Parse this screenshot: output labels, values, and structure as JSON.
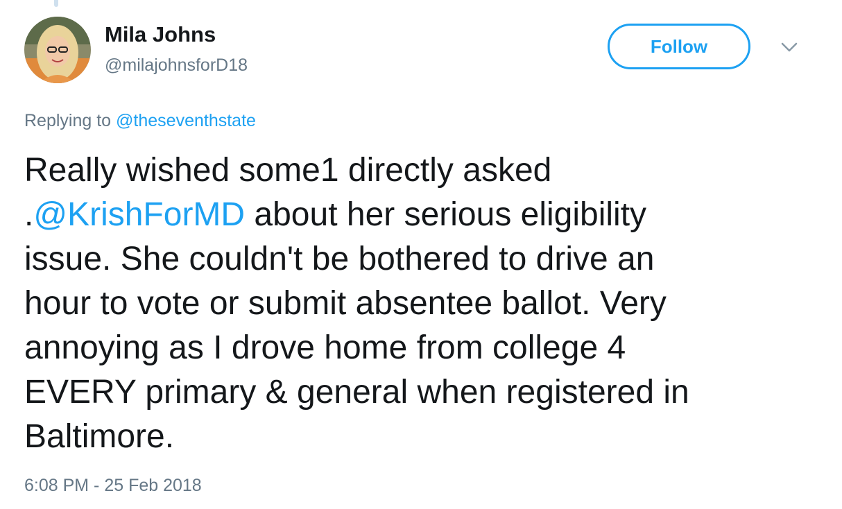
{
  "user": {
    "display_name": "Mila Johns",
    "handle": "@milajohnsforD18"
  },
  "follow_button": {
    "label": "Follow"
  },
  "menu": {
    "icon": "chevron-down-icon"
  },
  "reply": {
    "prefix": "Replying to ",
    "mention": "@theseventhstate"
  },
  "tweet": {
    "line1": "Really wished some1 directly asked",
    "line2_prefix": ".",
    "line2_mention": "@KrishForMD",
    "line2_rest": " about her serious eligibility",
    "line3": "issue. She couldn't be bothered to drive an",
    "line4": "hour to vote or submit absentee ballot. Very",
    "line5": "annoying as I drove home from college 4",
    "line6": "EVERY primary & general when registered in",
    "line7": "Baltimore."
  },
  "timestamp": "6:08 PM - 25 Feb 2018",
  "colors": {
    "accent": "#1da1f2",
    "text": "#14171a",
    "muted": "#657786"
  }
}
